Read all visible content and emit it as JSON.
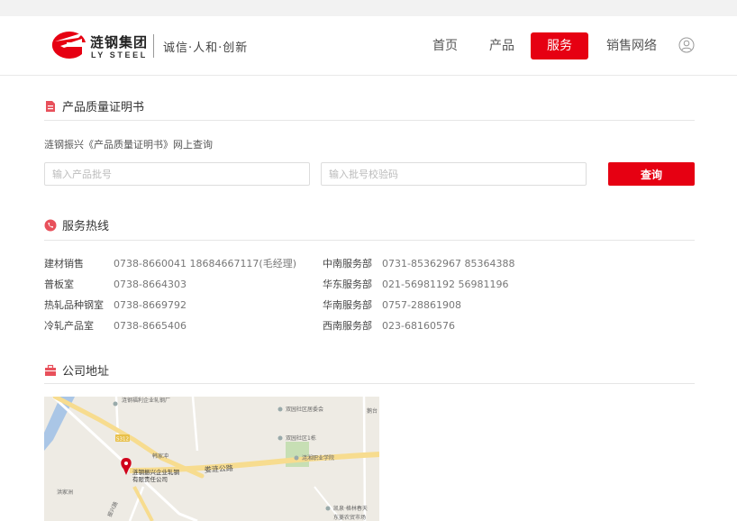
{
  "header": {
    "brand_cn": "涟钢集团",
    "brand_en": "LY STEEL",
    "slogan": "诚信·人和·创新",
    "nav": [
      {
        "label": "首页"
      },
      {
        "label": "产品"
      },
      {
        "label": "服务",
        "active": true
      },
      {
        "label": "销售网络"
      }
    ],
    "user_icon": "user-circle-icon"
  },
  "colors": {
    "accent": "#e60012",
    "rule": "#e6e6e6",
    "text": "#333333"
  },
  "certificate": {
    "title": "产品质量证明书",
    "icon": "document-icon",
    "description": "涟钢振兴《产品质量证明书》网上查询",
    "batch_placeholder": "输入产品批号",
    "code_placeholder": "输入批号校验码",
    "query_label": "查询"
  },
  "hotline": {
    "title": "服务热线",
    "icon": "phone-circle-icon",
    "left": [
      {
        "dept": "建材销售",
        "phone": "0738-8660041  18684667117(毛经理)"
      },
      {
        "dept": "普板室",
        "phone": "0738-8664303"
      },
      {
        "dept": "热轧品种钢室",
        "phone": "0738-8669792"
      },
      {
        "dept": "冷轧产品室",
        "phone": "0738-8665406"
      }
    ],
    "right": [
      {
        "dept": "中南服务部",
        "phone": "0731-85362967  85364388"
      },
      {
        "dept": "华东服务部",
        "phone": "021-56981192  56981196"
      },
      {
        "dept": "华南服务部",
        "phone": "0757-28861908"
      },
      {
        "dept": "西南服务部",
        "phone": "023-68160576"
      }
    ]
  },
  "address": {
    "title": "公司地址",
    "icon": "building-icon",
    "map": {
      "road_main": "娄涟公路",
      "road_shield": "S312",
      "marker_label_1": "涟钢振兴企业轧钢",
      "marker_label_2": "有限责任公司",
      "poi": [
        {
          "name": "涟钢福利企业轧钢厂"
        },
        {
          "name": "双园社区居委会"
        },
        {
          "name": "双园社区1栋"
        },
        {
          "name": "涟湘职业学院"
        },
        {
          "name": "韩家冲"
        },
        {
          "name": "洪家洲"
        },
        {
          "name": "振兴路"
        },
        {
          "name": "凯泉·格林春天"
        },
        {
          "name": "东菱农贸市场"
        },
        {
          "name": "鹅台"
        }
      ]
    }
  }
}
